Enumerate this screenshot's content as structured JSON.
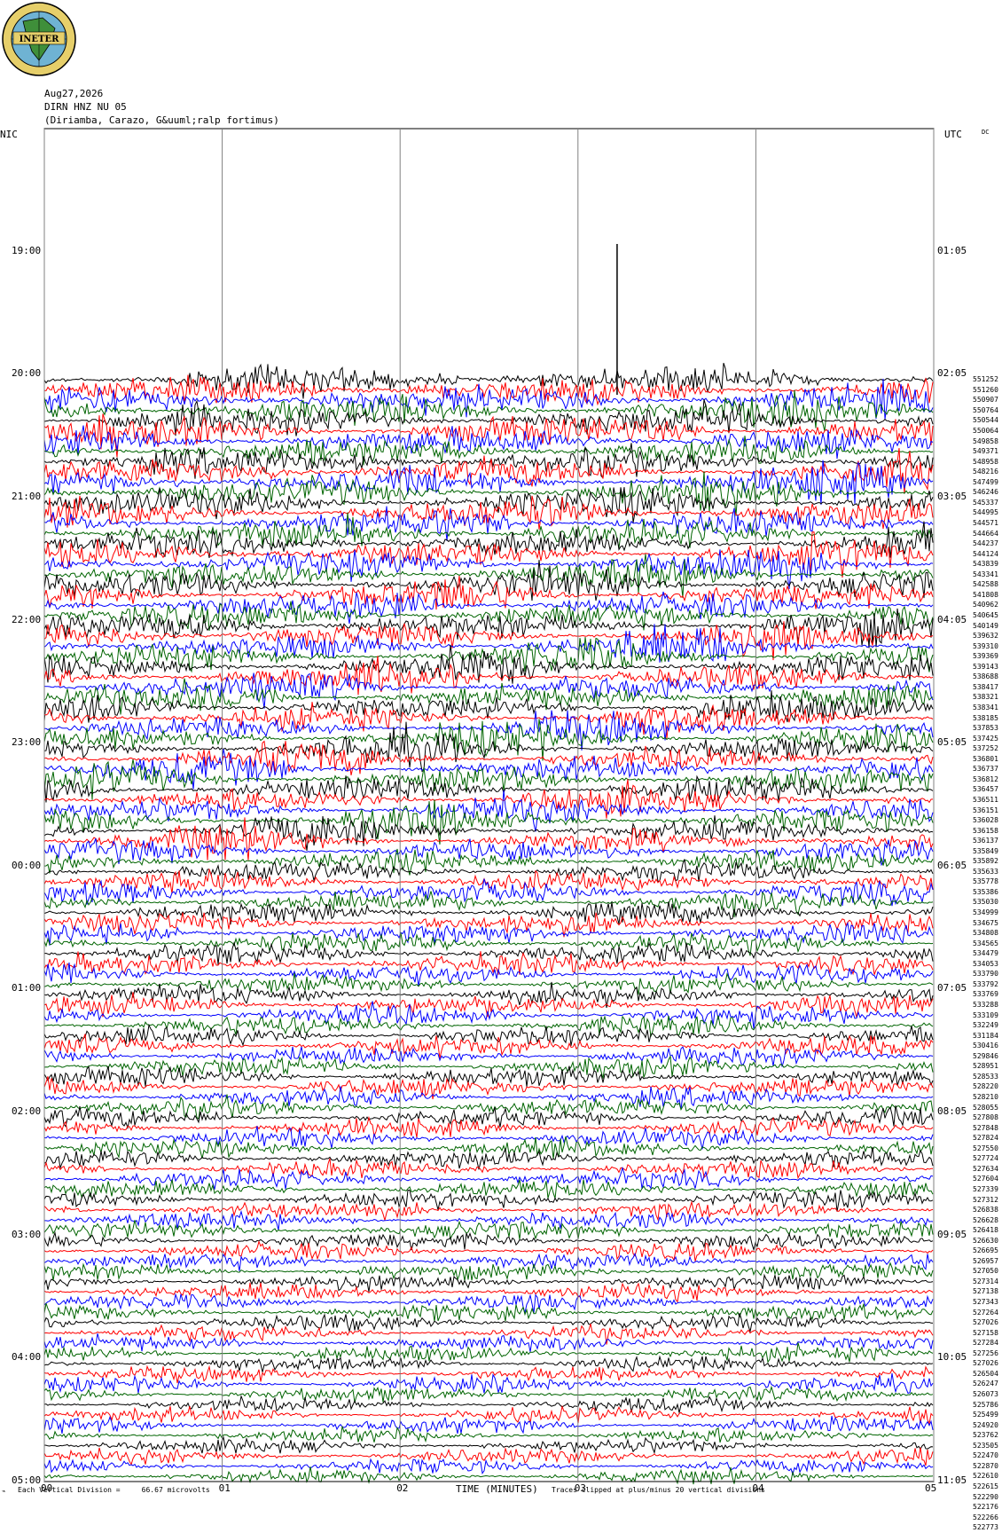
{
  "logo": {
    "text": "INETER",
    "colors": {
      "ring": "#b89a2a",
      "globe": "#5fa8c8",
      "land": "#3f8f3a"
    }
  },
  "header": {
    "date": "Aug27,2026",
    "station": "DIRN HNZ NU 05",
    "location": "(Diriamba, Carazo, G&uuml;ralp fortimus)"
  },
  "axis_titles": {
    "left": "NIC",
    "right": "UTC",
    "dc": "DC"
  },
  "footer": {
    "division": "Each Vertical Division =     66.67 microvolts",
    "xlabel": "TIME (MINUTES)",
    "clip_note": "Traces clipped at plus/minus 20 vertical divisions"
  },
  "chart_data": {
    "type": "line",
    "description_type": "helicorder",
    "x_ticks": [
      "00",
      "01",
      "02",
      "03",
      "04",
      "05"
    ],
    "xlim": [
      0,
      5
    ],
    "left_time_labels": [
      "19:00",
      "20:00",
      "21:00",
      "22:00",
      "23:00",
      "00:00",
      "01:00",
      "02:00",
      "03:00",
      "04:00",
      "05:00"
    ],
    "right_time_labels": [
      "01:05",
      "02:05",
      "03:05",
      "04:05",
      "05:05",
      "06:05",
      "07:05",
      "08:05",
      "09:05",
      "10:05",
      "11:05"
    ],
    "trace_colors": [
      "#000000",
      "#ff0000",
      "#0000ff",
      "#006400"
    ],
    "first_trace_row": 24,
    "rows_per_hour": 12,
    "dc_offsets": [
      551252,
      551260,
      550907,
      550764,
      550544,
      550064,
      549858,
      549371,
      548958,
      548216,
      547499,
      546246,
      545337,
      544995,
      544571,
      544664,
      544237,
      544124,
      543839,
      543341,
      542588,
      541808,
      540962,
      540645,
      540149,
      539632,
      539310,
      539369,
      539143,
      538688,
      538417,
      538321,
      538341,
      538185,
      537853,
      537425,
      537252,
      536801,
      536737,
      536812,
      536457,
      536511,
      536151,
      536028,
      536158,
      536137,
      535849,
      535892,
      535633,
      535778,
      535386,
      535030,
      534999,
      534675,
      534808,
      534565,
      534479,
      534053,
      533790,
      533792,
      533769,
      533288,
      533109,
      532249,
      531184,
      530416,
      529846,
      528951,
      528533,
      528220,
      528210,
      528055,
      527808,
      527848,
      527824,
      527550,
      527724,
      527634,
      527604,
      527339,
      527312,
      526838,
      526628,
      526418,
      526630,
      526695,
      526957,
      527050,
      527314,
      527138,
      527343,
      527264,
      527026,
      527158,
      527284,
      527256,
      527026,
      526504,
      526247,
      526073,
      525786,
      525499,
      524920,
      523762,
      523505,
      522470,
      522870,
      522610,
      522615,
      522290,
      522176,
      522266,
      522773
    ]
  }
}
